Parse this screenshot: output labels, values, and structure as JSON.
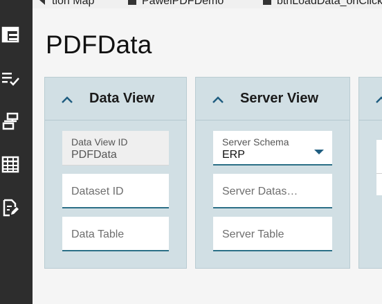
{
  "tabs": [
    {
      "label": "tion Map",
      "icon": "chevron-left-icon"
    },
    {
      "label": "PawelPDFDemo",
      "icon": "grid-icon"
    },
    {
      "label": "btnLoadData_onClick",
      "icon": "grid-icon"
    }
  ],
  "rail": {
    "icons": [
      "layout-icon",
      "checklist-icon",
      "hierarchy-icon",
      "table-icon",
      "edit-document-icon"
    ]
  },
  "page": {
    "title": "PDFData"
  },
  "panels": {
    "data_view": {
      "title": "Data View",
      "data_view_id_label": "Data View ID",
      "data_view_id_value": "PDFData",
      "dataset_id_placeholder": "Dataset ID",
      "data_table_placeholder": "Data Table"
    },
    "server_view": {
      "title": "Server View",
      "server_schema_label": "Server Schema",
      "server_schema_value": "ERP",
      "server_dataset_placeholder": "Server Datas…",
      "server_table_placeholder": "Server Table"
    }
  },
  "colors": {
    "rail": "#2d2d2d",
    "panel": "#d1dfe4",
    "accent": "#2b6f86",
    "caret": "#1f5d80"
  }
}
